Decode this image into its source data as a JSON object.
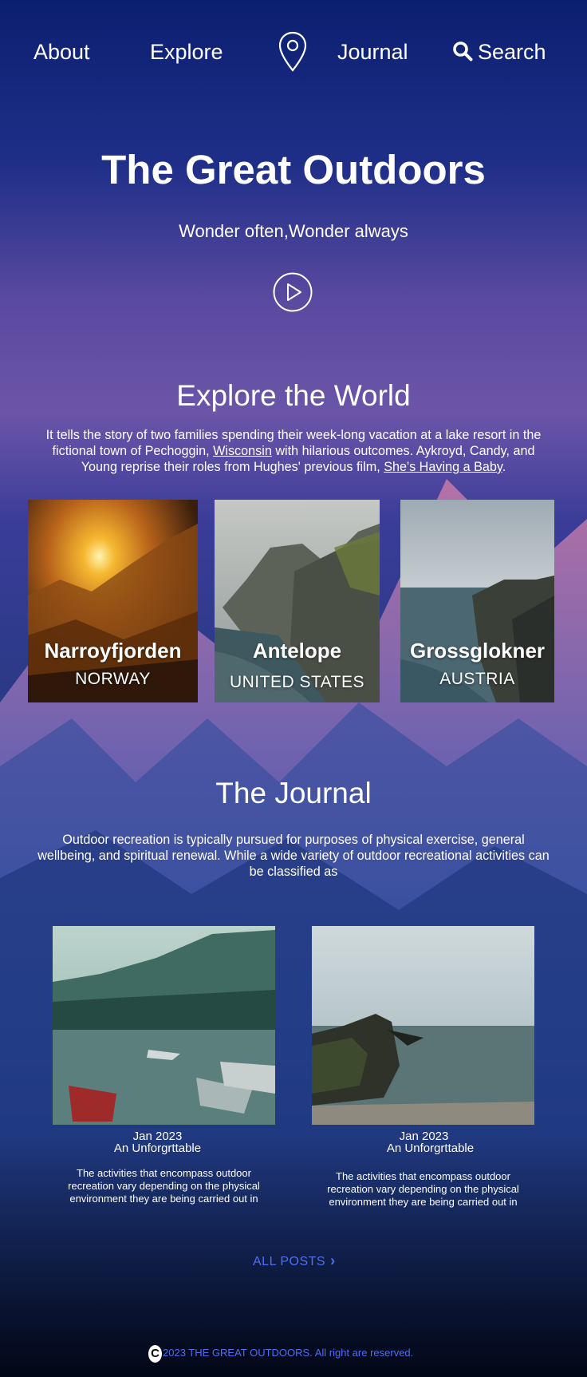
{
  "nav": {
    "about": "About",
    "explore": "Explore",
    "journal": "Journal",
    "search": "Search"
  },
  "hero": {
    "title": "The Great Outdoors",
    "subtitle": "Wonder often,Wonder always"
  },
  "explore": {
    "title": "Explore the World",
    "text_1": "It tells the story of two families spending their week-long vacation at a lake resort in the fictional town of Pechoggin, ",
    "link_1": "Wisconsin",
    "text_2": " with hilarious outcomes. Aykroyd, Candy, and Young reprise their roles from Hughes' previous film, ",
    "link_2": "She's Having a Baby",
    "text_3": ".",
    "cards": [
      {
        "name": "Narroyfjorden",
        "country": "NORWAY"
      },
      {
        "name": "Antelope",
        "country": "UNITED STATES"
      },
      {
        "name": "Grossglokner",
        "country": "AUSTRIA"
      }
    ]
  },
  "journal": {
    "title": "The Journal",
    "text": "Outdoor recreation is typically pursued for purposes of physical exercise, general wellbeing, and spiritual renewal. While a wide variety of outdoor recreational activities can be classified as",
    "posts": [
      {
        "date": "Jan 2023",
        "title": "An Unforgrttable",
        "desc": "The activities that encompass outdoor recreation vary depending on the physical environment they are being carried out in"
      },
      {
        "date": "Jan 2023",
        "title": "An Unforgrttable",
        "desc": "The activities that encompass outdoor recreation vary depending on the physical environment they are being carried out in"
      }
    ],
    "all_posts": "ALL POSTS"
  },
  "footer": {
    "copy_symbol": "C",
    "text": "2023 THE GREAT OUTDOORS. All right are reserved."
  },
  "colors": {
    "accent": "#4f6ef0",
    "background_top": "#0a1d6b",
    "background_bottom": "#020817"
  },
  "icons": [
    "map-pin-icon",
    "search-icon",
    "play-icon",
    "chevron-right-icon",
    "copyright-icon"
  ]
}
